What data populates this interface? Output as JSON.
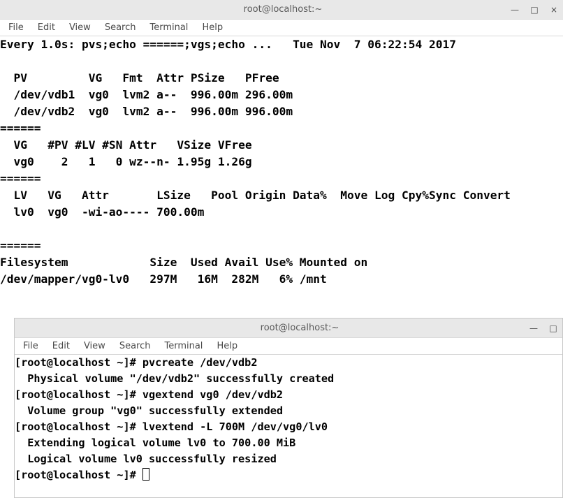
{
  "top_window": {
    "title": "root@localhost:~",
    "menu": [
      "File",
      "Edit",
      "View",
      "Search",
      "Terminal",
      "Help"
    ],
    "lines": {
      "watch_header": "Every 1.0s: pvs;echo ======;vgs;echo ...   Tue Nov  7 06:22:54 2017",
      "blank1": "",
      "pv_header": "  PV         VG   Fmt  Attr PSize   PFree",
      "pv_row1": "  /dev/vdb1  vg0  lvm2 a--  996.00m 296.00m",
      "pv_row2": "  /dev/vdb2  vg0  lvm2 a--  996.00m 996.00m",
      "sep1": "======",
      "vg_header": "  VG   #PV #LV #SN Attr   VSize VFree",
      "vg_row1": "  vg0    2   1   0 wz--n- 1.95g 1.26g",
      "sep2": "======",
      "lv_header": "  LV   VG   Attr       LSize   Pool Origin Data%  Move Log Cpy%Sync Convert",
      "lv_row1": "  lv0  vg0  -wi-ao---- 700.00m",
      "blank2": "",
      "sep3": "======",
      "df_header": "Filesystem            Size  Used Avail Use% Mounted on",
      "df_row1": "/dev/mapper/vg0-lv0   297M   16M  282M   6% /mnt"
    }
  },
  "bottom_window": {
    "title": "root@localhost:~",
    "menu": [
      "File",
      "Edit",
      "View",
      "Search",
      "Terminal",
      "Help"
    ],
    "lines": {
      "l1": "[root@localhost ~]# pvcreate /dev/vdb2",
      "l2": "  Physical volume \"/dev/vdb2\" successfully created",
      "l3": "[root@localhost ~]# vgextend vg0 /dev/vdb2",
      "l4": "  Volume group \"vg0\" successfully extended",
      "l5": "[root@localhost ~]# lvextend -L 700M /dev/vg0/lv0",
      "l6": "  Extending logical volume lv0 to 700.00 MiB",
      "l7": "  Logical volume lv0 successfully resized",
      "l8": "[root@localhost ~]# "
    }
  },
  "icons": {
    "minimize": "—",
    "maximize": "□",
    "close": "×"
  }
}
